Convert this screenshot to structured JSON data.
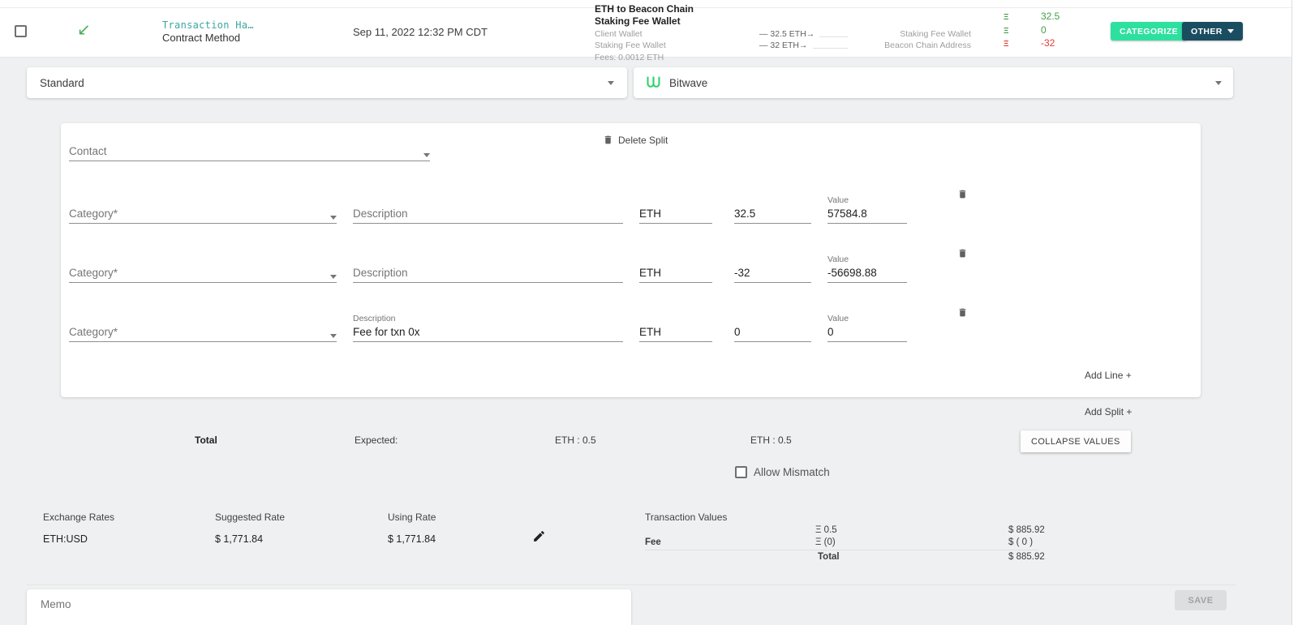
{
  "colors": {
    "accent_green": "#2ee0a0",
    "dark_navy": "#1b4d61",
    "positive": "#43a047",
    "negative": "#e53935",
    "link_teal": "#3aa6a2",
    "bitwave_green": "#2dd36f"
  },
  "header": {
    "tx_link": "Transaction Ha…",
    "tx_method": "Contract Method",
    "date": "Sep 11, 2022 12:32 PM CDT",
    "title_line1": "ETH to Beacon Chain",
    "title_line2": "Staking Fee Wallet",
    "transfers": [
      {
        "from": "Client Wallet",
        "amount": "— 32.5 ETH→",
        "to": "Staking Fee Wallet"
      },
      {
        "from": "Staking Fee Wallet",
        "amount": "— 32 ETH→",
        "to": "Beacon Chain Address"
      }
    ],
    "fees": "Fees: 0.0012 ETH",
    "eth_symbol": "Ξ",
    "amounts": [
      "32.5",
      "0",
      "-32"
    ],
    "categorize_label": "CATEGORIZE",
    "other_label": "OTHER"
  },
  "selectors": {
    "template": "Standard",
    "connection": "Bitwave"
  },
  "split": {
    "contact_placeholder": "Contact",
    "delete_split_label": "Delete Split",
    "add_line_label": "Add Line +",
    "add_split_label": "Add Split +",
    "lines": [
      {
        "category_placeholder": "Category*",
        "description_placeholder": "Description",
        "description": "",
        "ticker": "ETH",
        "amount": "32.5",
        "value_label": "Value",
        "value": "57584.8"
      },
      {
        "category_placeholder": "Category*",
        "description_placeholder": "Description",
        "description": "",
        "ticker": "ETH",
        "amount": "-32",
        "value_label": "Value",
        "value": "-56698.88"
      },
      {
        "category_placeholder": "Category*",
        "description_label": "Description",
        "description": "Fee for txn 0x",
        "ticker": "ETH",
        "amount": "0",
        "value_label": "Value",
        "value": "0"
      }
    ]
  },
  "totals": {
    "total_label": "Total",
    "expected_label": "Expected:",
    "line_total": "ETH : 0.5",
    "expected_value": "ETH : 0.5",
    "collapse_label": "COLLAPSE VALUES",
    "allow_mismatch_label": "Allow Mismatch"
  },
  "rates": {
    "exchange_rates_label": "Exchange Rates",
    "suggested_label": "Suggested Rate",
    "using_label": "Using Rate",
    "pair": "ETH:USD",
    "suggested_value": "$ 1,771.84",
    "using_value": "$ 1,771.84"
  },
  "transaction_values": {
    "label": "Transaction Values",
    "rows": [
      {
        "name": "",
        "eth": "Ξ 0.5",
        "usd": "$ 885.92"
      },
      {
        "name": "Fee",
        "eth": "Ξ (0)",
        "usd": "$ ( 0 )"
      }
    ],
    "total_label": "Total",
    "total_usd": "$ 885.92"
  },
  "footer": {
    "memo_placeholder": "Memo",
    "save_label": "SAVE"
  }
}
